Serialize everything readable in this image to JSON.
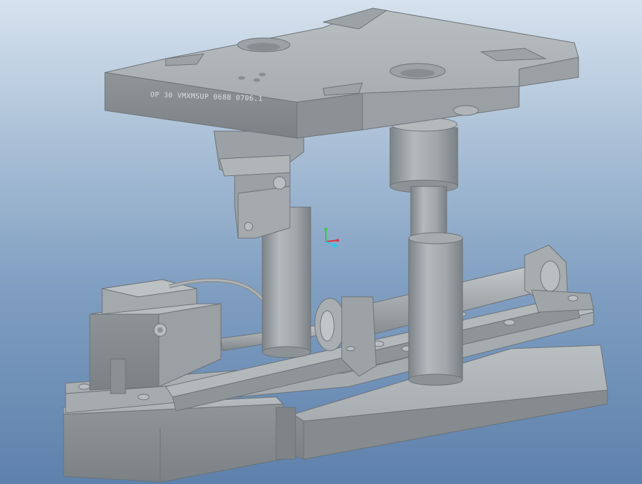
{
  "viewport": {
    "background_top": "#d6e2ee",
    "background_bottom": "#5e81ac",
    "model_color": "#a8adb0"
  },
  "model": {
    "engraving": "OP 30 VMXMSUP 068B 0706.1"
  },
  "triad": {
    "x_axis_color": "#e0323c",
    "y_axis_color": "#2fcc3a",
    "z_axis_color": "#2ec8e6"
  }
}
